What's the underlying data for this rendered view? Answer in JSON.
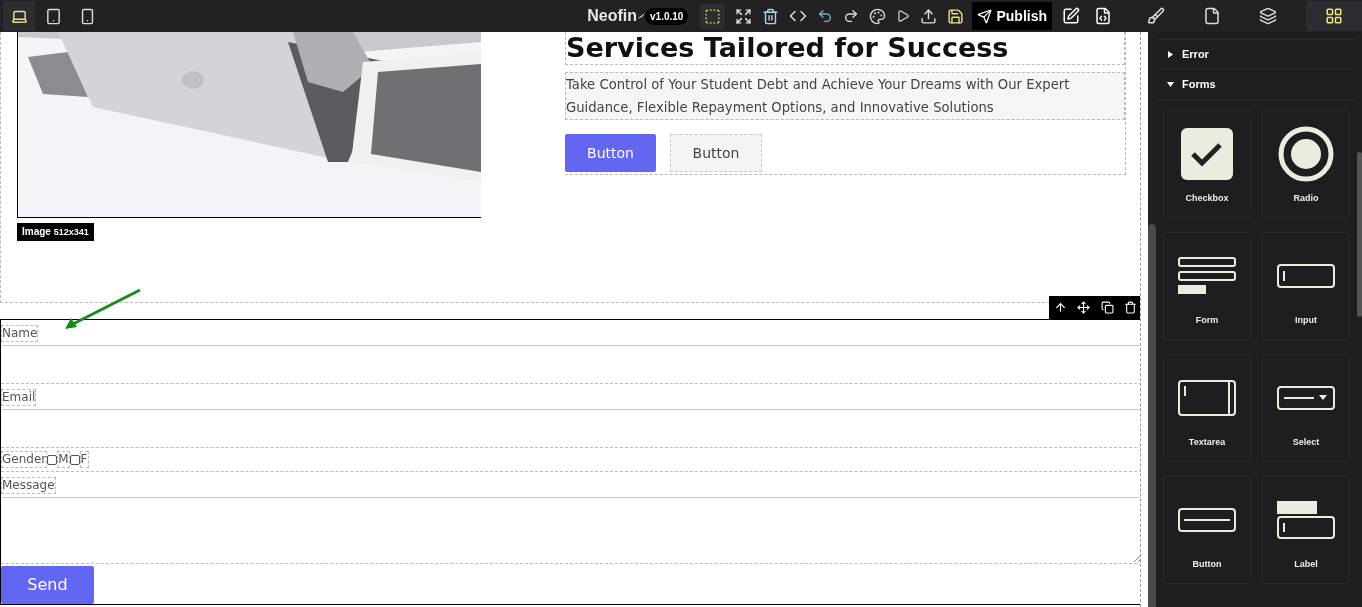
{
  "topbar": {
    "devices": [
      {
        "kind": "desktop",
        "selected": true
      },
      {
        "kind": "tablet",
        "selected": false
      },
      {
        "kind": "mobile",
        "selected": false
      }
    ],
    "brand": "Neofin",
    "version": "v1.0.10",
    "publish": "Publish",
    "panel_tabs": [
      {
        "kind": "style",
        "selected": false
      },
      {
        "kind": "page",
        "selected": false
      },
      {
        "kind": "layers",
        "selected": false
      },
      {
        "kind": "blocks",
        "selected": true
      }
    ]
  },
  "canvas": {
    "image_badge": {
      "label": "Image",
      "size": "512x341"
    },
    "heading": "Services Tailored for Success",
    "paragraph": "Take Control of Your Student Debt and Achieve Your Dreams with Our Expert Guidance, Flexible Repayment Options, and Innovative Solutions",
    "buttons": [
      {
        "label": "Button",
        "kind": "primary"
      },
      {
        "label": "Button",
        "kind": "secondary"
      }
    ],
    "form": {
      "fields": [
        {
          "kind": "text",
          "label": "Name"
        },
        {
          "kind": "text",
          "label": "Email"
        },
        {
          "kind": "choices",
          "label": "Gender",
          "options": [
            {
              "label": "M",
              "checked": false
            },
            {
              "label": "F",
              "checked": false
            }
          ]
        },
        {
          "kind": "textarea",
          "label": "Message"
        }
      ],
      "submit": "Send"
    }
  },
  "panel": {
    "categories": [
      {
        "label": "Error",
        "expanded": false
      },
      {
        "label": "Forms",
        "expanded": true
      }
    ],
    "blocks": [
      {
        "kind": "checkbox",
        "label": "Checkbox"
      },
      {
        "kind": "radio",
        "label": "Radio"
      },
      {
        "kind": "form",
        "label": "Form"
      },
      {
        "kind": "input",
        "label": "Input"
      },
      {
        "kind": "textarea",
        "label": "Textarea"
      },
      {
        "kind": "select",
        "label": "Select"
      },
      {
        "kind": "button",
        "label": "Button"
      },
      {
        "kind": "label",
        "label": "Label"
      }
    ]
  }
}
